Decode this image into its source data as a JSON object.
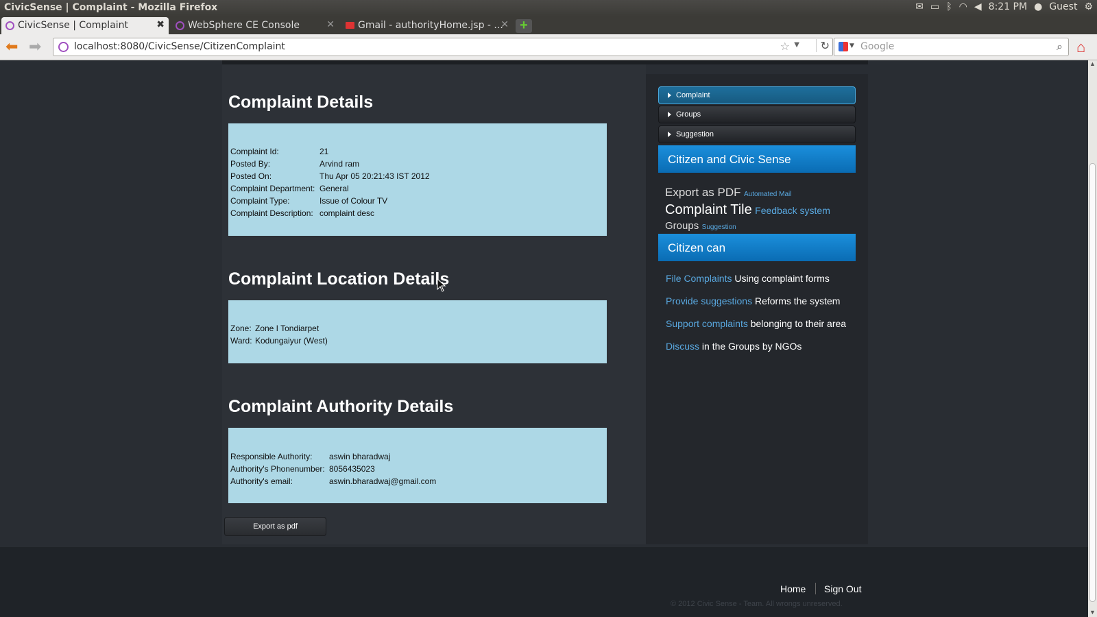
{
  "window": {
    "title": "CivicSense | Complaint - Mozilla Firefox"
  },
  "tray": {
    "time": "8:21 PM",
    "user": "Guest"
  },
  "tabs": [
    {
      "label": "CivicSense | Complaint"
    },
    {
      "label": "WebSphere CE Console"
    },
    {
      "label": "Gmail - authorityHome.jsp - ..."
    }
  ],
  "nav": {
    "url": "localhost:8080/CivicSense/CitizenComplaint",
    "search_placeholder": "Google"
  },
  "complaint": {
    "heading": "Complaint Details",
    "rows": [
      {
        "label": "Complaint Id:",
        "value": "21"
      },
      {
        "label": "Posted By:",
        "value": "Arvind ram"
      },
      {
        "label": "Posted On:",
        "value": "Thu Apr 05 20:21:43 IST 2012"
      },
      {
        "label": "Complaint Department:",
        "value": "General"
      },
      {
        "label": "Complaint Type:",
        "value": "Issue of Colour TV"
      },
      {
        "label": "Complaint Description:",
        "value": "complaint desc"
      }
    ]
  },
  "location": {
    "heading": "Complaint Location Details",
    "rows": [
      {
        "label": "Zone:",
        "value": "Zone I Tondiarpet"
      },
      {
        "label": "Ward:",
        "value": "Kodungaiyur (West)"
      }
    ]
  },
  "authority": {
    "heading": "Complaint Authority Details",
    "rows": [
      {
        "label": "Responsible Authority:",
        "value": "aswin bharadwaj"
      },
      {
        "label": "Authority's Phonenumber:",
        "value": "8056435023"
      },
      {
        "label": "Authority's email:",
        "value": "aswin.bharadwaj@gmail.com"
      }
    ]
  },
  "export_button": "Export as pdf",
  "sidebar": {
    "accordion": [
      "Complaint",
      "Groups",
      "Suggestion"
    ],
    "heading1": "Citizen and Civic Sense",
    "cloud": {
      "t1": "Export as PDF",
      "t2": "Automated Mail",
      "t3": "Complaint Tile",
      "t4": "Feedback system",
      "t5": "Groups",
      "t6": "Suggestion"
    },
    "heading2": "Citizen can",
    "can": [
      {
        "link": "File Complaints",
        "text": "Using complaint forms"
      },
      {
        "link": "Provide suggestions",
        "text": "Reforms the system"
      },
      {
        "link": "Support complaints",
        "text": "belonging to their area"
      },
      {
        "link": "Discuss",
        "text": "in the Groups by NGOs"
      }
    ]
  },
  "footer": {
    "home": "Home",
    "signout": "Sign Out",
    "copyright": "© 2012 Civic Sense - Team. All wrongs unreserved."
  },
  "colors": {
    "accent_blue": "#1b8fdc",
    "box_bg": "#add8e6",
    "link": "#59a8e0"
  }
}
